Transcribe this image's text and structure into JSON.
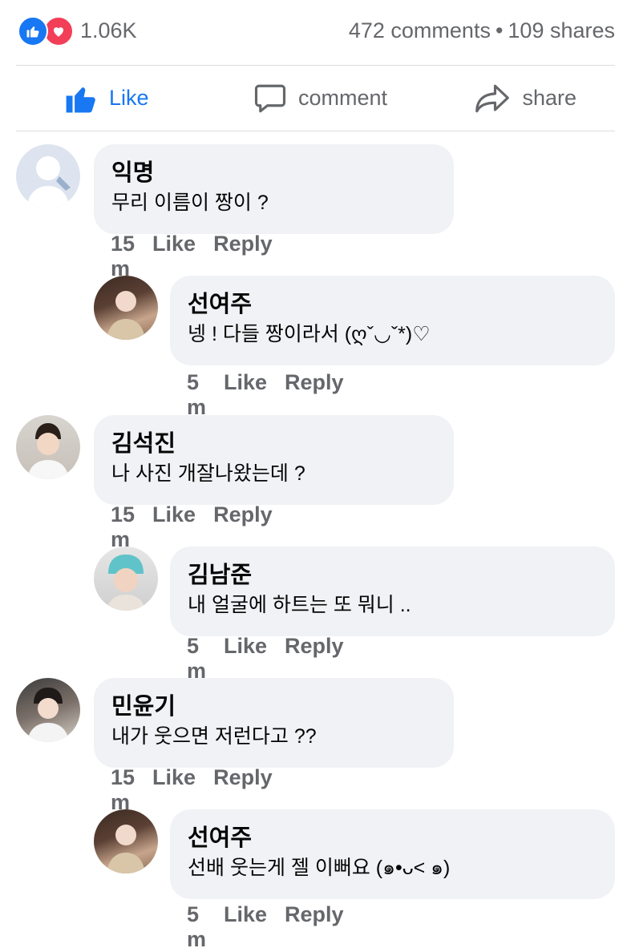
{
  "reactions": {
    "count": "1.06K",
    "comments": "472 comments",
    "separator": "•",
    "shares": "109 shares",
    "like_color": "#1877f2",
    "love_color": "#f33e58"
  },
  "actions": {
    "like": "Like",
    "comment": "comment",
    "share": "share"
  },
  "comments": [
    {
      "author": "익명",
      "text": "무리 이름이 짱이 ?",
      "time": "15 m",
      "like": "Like",
      "reply": "Reply",
      "avatar": "anonymous-avatar"
    },
    {
      "author": "선여주",
      "text": "넹 ! 다들 짱이라서 (ღˇ◡ˇ*)♡",
      "time": "5 m",
      "like": "Like",
      "reply": "Reply",
      "avatar": "user-avatar"
    },
    {
      "author": "김석진",
      "text": "나 사진 개잘나왔는데 ?",
      "time": "15 m",
      "like": "Like",
      "reply": "Reply",
      "avatar": "user-avatar"
    },
    {
      "author": "김남준",
      "text": "내 얼굴에 하트는 또 뭐니 ..",
      "time": "5 m",
      "like": "Like",
      "reply": "Reply",
      "avatar": "user-avatar"
    },
    {
      "author": "민윤기",
      "text": "내가 웃으면 저런다고 ??",
      "time": "15 m",
      "like": "Like",
      "reply": "Reply",
      "avatar": "user-avatar"
    },
    {
      "author": "선여주",
      "text": "선배 웃는게 젤 이뻐요 (๑•ᴗ< ๑)",
      "time": "5 m",
      "like": "Like",
      "reply": "Reply",
      "avatar": "user-avatar"
    }
  ]
}
